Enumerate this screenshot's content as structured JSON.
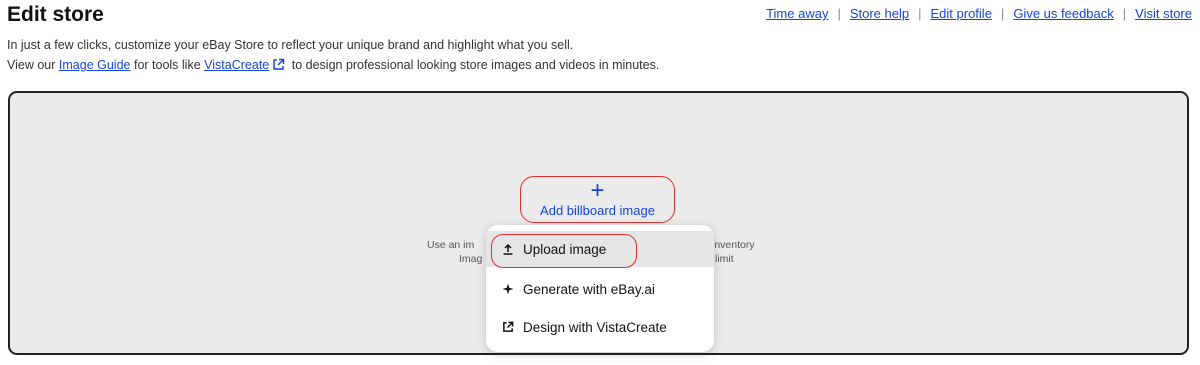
{
  "header": {
    "title": "Edit store",
    "links": [
      "Time away",
      "Store help",
      "Edit profile",
      "Give us feedback",
      "Visit store"
    ]
  },
  "description": {
    "line1": "In just a few clicks, customize your eBay Store to reflect your unique brand and highlight what you sell.",
    "line2_prefix": "View our",
    "image_guide_link": "Image Guide",
    "line2_middle": "for tools like",
    "vistacreate_link": "VistaCreate",
    "line2_suffix": "to design professional looking store images and videos in minutes."
  },
  "billboard": {
    "add_label": "Add billboard image",
    "hint_left_1": "Use an im",
    "hint_left_2": "Imag",
    "hint_right_1": "inventory",
    "hint_right_2": "limit"
  },
  "menu": {
    "items": [
      {
        "label": "Upload image",
        "icon": "upload-icon"
      },
      {
        "label": "Generate with eBay.ai",
        "icon": "sparkle-icon"
      },
      {
        "label": "Design with VistaCreate",
        "icon": "external-link-icon"
      }
    ]
  },
  "colors": {
    "link": "#1545d8",
    "highlight_outline": "#d93131",
    "billboard_bg": "#ebebeb"
  }
}
